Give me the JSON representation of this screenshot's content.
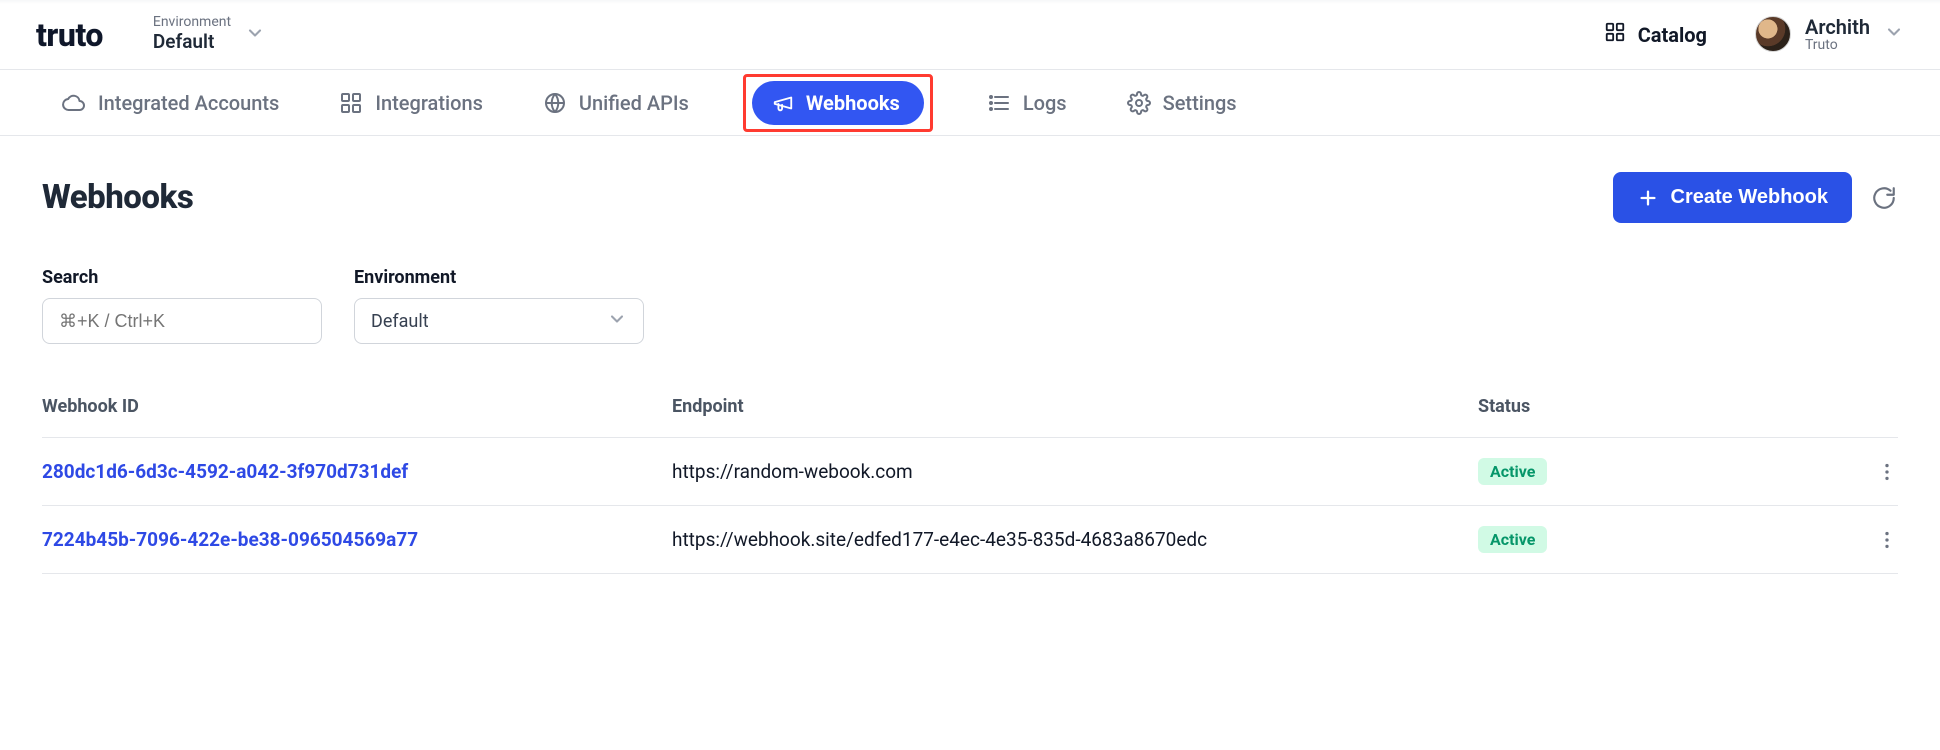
{
  "brand": "truto",
  "env_switcher": {
    "label": "Environment",
    "value": "Default"
  },
  "header": {
    "catalog": "Catalog",
    "user": {
      "name": "Archith",
      "org": "Truto"
    }
  },
  "nav": {
    "integrated_accounts": "Integrated Accounts",
    "integrations": "Integrations",
    "unified_apis": "Unified APIs",
    "webhooks": "Webhooks",
    "logs": "Logs",
    "settings": "Settings"
  },
  "page": {
    "title": "Webhooks",
    "create_button": "Create Webhook"
  },
  "filters": {
    "search_label": "Search",
    "search_placeholder": "⌘+K / Ctrl+K",
    "env_label": "Environment",
    "env_value": "Default"
  },
  "table": {
    "headers": {
      "id": "Webhook ID",
      "endpoint": "Endpoint",
      "status": "Status"
    },
    "rows": [
      {
        "id": "280dc1d6-6d3c-4592-a042-3f970d731def",
        "endpoint": "https://random-webook.com",
        "status": "Active"
      },
      {
        "id": "7224b45b-7096-422e-be38-096504569a77",
        "endpoint": "https://webhook.site/edfed177-e4ec-4e35-835d-4683a8670edc",
        "status": "Active"
      }
    ]
  }
}
